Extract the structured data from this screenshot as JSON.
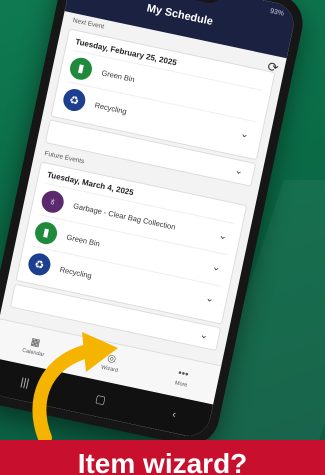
{
  "app": {
    "title": "My Schedule",
    "status": "93%"
  },
  "next_event": {
    "section_label": "Next Event",
    "date": "Tuesday, February 25, 2025",
    "items": [
      {
        "label": "Green Bin",
        "icon": "green-bin-icon",
        "color": "#1f8a3b"
      },
      {
        "label": "Recycling",
        "icon": "recycle-icon",
        "color": "#1d3f8f"
      }
    ]
  },
  "future_events": {
    "section_label": "Future Events",
    "date": "Tuesday, March 4, 2025",
    "items": [
      {
        "label": "Garbage - Clear Bag Collection",
        "icon": "garbage-bag-icon",
        "color": "#5b2a6e"
      },
      {
        "label": "Green Bin",
        "icon": "green-bin-icon",
        "color": "#1f8a3b"
      },
      {
        "label": "Recycling",
        "icon": "recycle-icon",
        "color": "#1d3f8f"
      }
    ]
  },
  "bottom_nav": [
    {
      "label": "Calendar",
      "icon": "calendar-icon"
    },
    {
      "label": "Wizard",
      "icon": "wizard-icon"
    },
    {
      "label": "More",
      "icon": "more-icon"
    }
  ],
  "banner": {
    "text": "Item wizard?",
    "color": "#c8102e"
  },
  "accent": {
    "arrow": "#f5b400"
  }
}
